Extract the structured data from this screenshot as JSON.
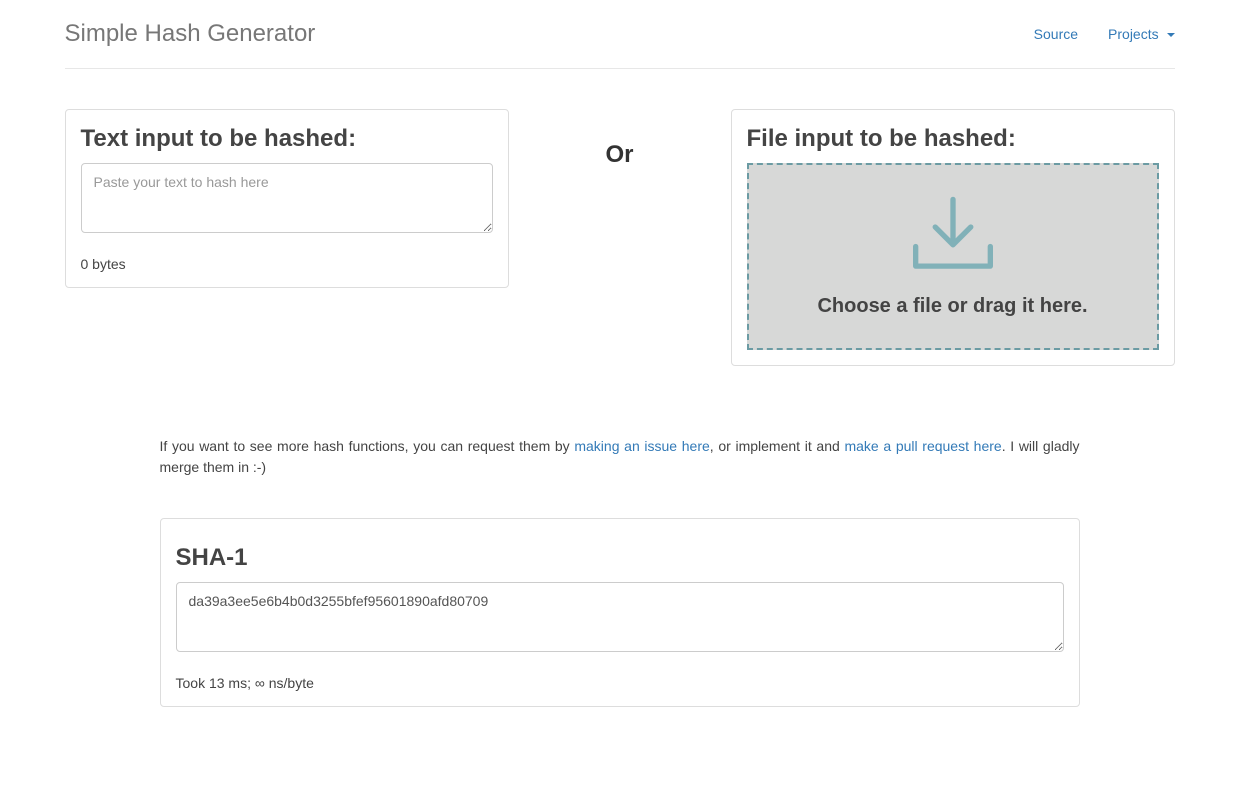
{
  "nav": {
    "brand": "Simple Hash Generator",
    "source_label": "Source",
    "projects_label": "Projects"
  },
  "input": {
    "text_heading": "Text input to be hashed:",
    "text_placeholder": "Paste your text to hash here",
    "text_value": "",
    "bytes_label": "0 bytes",
    "or_label": "Or",
    "file_heading": "File input to be hashed:",
    "dropzone_text": "Choose a file or drag it here."
  },
  "info": {
    "prefix": "If you want to see more hash functions, you can request them by ",
    "link1": "making an issue here",
    "mid": ", or implement it and ",
    "link2": "make a pull request here",
    "suffix": ". I will gladly merge them in :-)"
  },
  "result": {
    "algo_name": "SHA-1",
    "hash_value": "da39a3ee5e6b4b0d3255bfef95601890afd80709",
    "timing": "Took 13 ms; ∞ ns/byte"
  }
}
